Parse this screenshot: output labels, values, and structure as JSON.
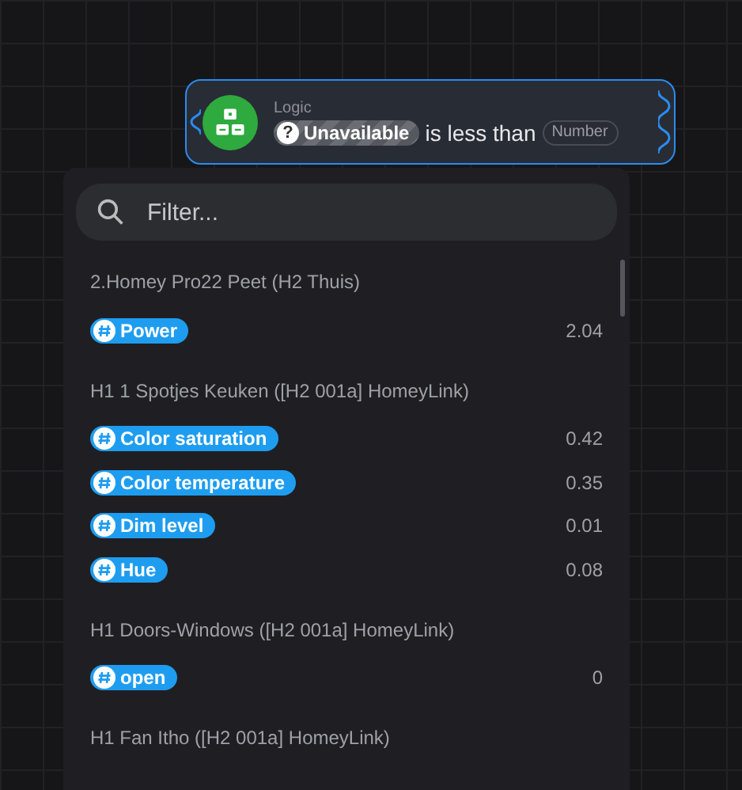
{
  "node": {
    "category": "Logic",
    "token": {
      "label": "Unavailable",
      "icon": "?"
    },
    "text": "is less than",
    "argument": {
      "placeholder": "Number"
    }
  },
  "dropdown": {
    "search": {
      "placeholder": "Filter..."
    },
    "groups": [
      {
        "title": "2.Homey Pro22 Peet (H2 Thuis)",
        "items": [
          {
            "label": "Power",
            "value": "2.04"
          }
        ]
      },
      {
        "title": "H1 1 Spotjes Keuken ([H2 001a] HomeyLink)",
        "items": [
          {
            "label": "Color saturation",
            "value": "0.42"
          },
          {
            "label": "Color temperature",
            "value": "0.35"
          },
          {
            "label": "Dim level",
            "value": "0.01"
          },
          {
            "label": "Hue",
            "value": "0.08"
          }
        ]
      },
      {
        "title": "H1 Doors-Windows ([H2 001a] HomeyLink)",
        "items": [
          {
            "label": "open",
            "value": "0"
          }
        ]
      },
      {
        "title": "H1 Fan Itho ([H2 001a] HomeyLink)"
      }
    ]
  }
}
